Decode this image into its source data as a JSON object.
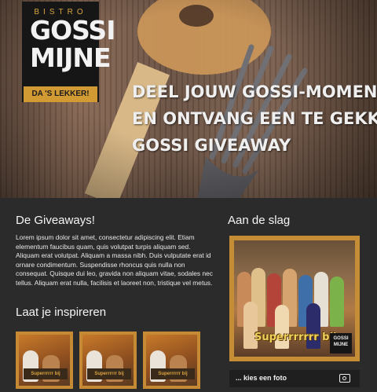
{
  "hero": {
    "logo": {
      "top": "BISTRO",
      "line1": "GOSSI",
      "line2": "MIJNE",
      "tagline": "DA 'S LEKKER!"
    },
    "headline": [
      "DEEL JOUW GOSSI-MOMENT",
      "EN ONTVANG EEN TE GEKKE",
      "GOSSI GIVEAWAY"
    ]
  },
  "giveaways": {
    "title": "De Giveaways!",
    "text": "Lorem ipsum dolor sit amet, consectetur adipiscing elit. Etiam elementum faucibus quam, quis volutpat turpis aliquam sed. Aliquam erat volutpat. Aliquam a massa nibh. Duis vulputate erat id ornare condimentum. Suspendisse rhoncus quis nulla non consequat. Quisque dui leo, gravida non aliquam vitae, sodales nec tellus. Aliquam erat nulla, facilisis et laoreet non, tristique vel metus."
  },
  "inspire": {
    "title": "Laat je inspireren",
    "thumb_caption": "Superrrrrr bij"
  },
  "action": {
    "title": "Aan de slag",
    "photo_caption": "Superrrrrrr bij",
    "photo_logo": "GOSSI MIJNE",
    "choose_label": "... kies een foto"
  },
  "icons": {
    "camera": "camera-icon"
  },
  "colors": {
    "accent": "#c48d36",
    "background": "#2b2b2b"
  }
}
